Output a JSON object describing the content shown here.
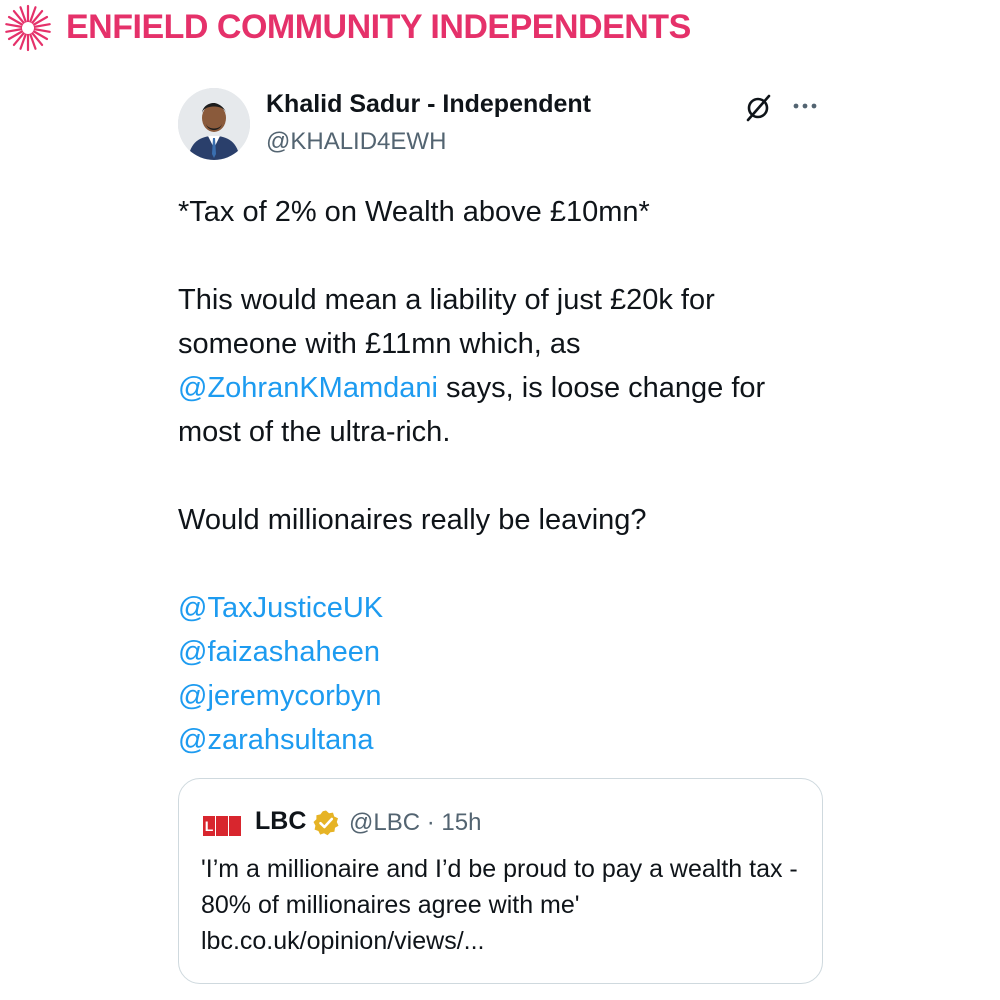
{
  "banner": {
    "title": "ENFIELD COMMUNITY INDEPENDENTS",
    "logo_icon": "sunburst-logo",
    "color": "#e5316a"
  },
  "tweet": {
    "author": {
      "display_name": "Khalid Sadur - Independent",
      "handle": "@KHALID4EWH",
      "avatar_icon": "avatar"
    },
    "actions": {
      "grok_icon": "grok-icon",
      "more_icon": "more-icon"
    },
    "body": {
      "line1": "*Tax of 2% on Wealth above £10mn*",
      "para2_part1": "This would mean a liability of just £20k for someone with £11mn which, as ",
      "para2_mention": "@ZohranKMamdani",
      "para2_part2": " says, is loose change for most of the ultra-rich.",
      "line3": "Would millionaires really be leaving?",
      "mentions": [
        "@TaxJusticeUK",
        "@faizashaheen",
        "@jeremycorbyn",
        "@zarahsultana"
      ]
    },
    "mention_color": "#1d9bf0",
    "quote": {
      "logo_text": "LBC",
      "name": "LBC",
      "verified_icon": "verified-gold-badge-icon",
      "handle": "@LBC",
      "separator": "·",
      "time": "15h",
      "text": "'I’m a millionaire and I’d be proud to pay a wealth tax - 80% of millionaires agree with me' lbc.co.uk/opinion/views/..."
    }
  }
}
